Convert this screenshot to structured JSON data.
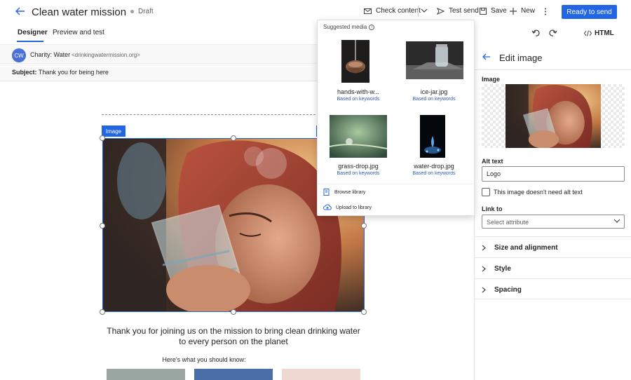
{
  "header": {
    "title": "Clean water mission",
    "status": "Draft",
    "check_content": "Check content",
    "test_send": "Test send",
    "save": "Save",
    "new": "New",
    "ready": "Ready to send"
  },
  "tabs": [
    "Designer",
    "Preview and test"
  ],
  "sender": {
    "initials": "CW",
    "name": "Charity: Water",
    "email": "<drinkingwatermission.org>",
    "subject_label": "Subject:",
    "subject": "Thank you for being here"
  },
  "canvas": {
    "image_tag": "Image",
    "body": "Thank you for joining us on the mission to bring clean drinking water to every person on the planet",
    "know": "Here's what you should know:"
  },
  "toolbar2": {
    "html": "HTML"
  },
  "panel": {
    "title": "Edit image",
    "image_label": "Image",
    "alt_label": "Alt text",
    "alt_value": "Logo",
    "no_alt": "This image doesn't need alt text",
    "link_label": "Link to",
    "link_placeholder": "Select attribute",
    "sections": [
      "Size and alignment",
      "Style",
      "Spacing"
    ]
  },
  "popup": {
    "title": "Suggested media",
    "items": [
      {
        "name": "hands-with-w...",
        "sub": "Based on keywords"
      },
      {
        "name": "ice-jar.jpg",
        "sub": "Based on keywords"
      },
      {
        "name": "grass-drop.jpg",
        "sub": "Based on keywords"
      },
      {
        "name": "water-drop.jpg",
        "sub": "Based on keywords"
      }
    ],
    "browse": "Browse library",
    "upload": "Upload to library"
  },
  "colors": {
    "accent": "#2266e3",
    "link": "#2e5ab8"
  }
}
